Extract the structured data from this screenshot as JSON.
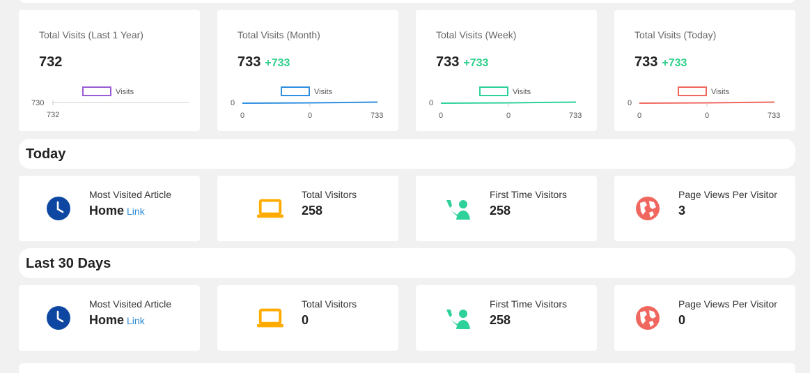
{
  "stats": [
    {
      "title": "Total Visits (Last 1 Year)",
      "value": "732",
      "delta": "",
      "legend": "Visits",
      "color": "#9a5dd6",
      "chart_data": {
        "type": "line",
        "series": [
          {
            "name": "Visits",
            "x": [
              "732"
            ],
            "y": [
              730
            ]
          }
        ],
        "ytick": "730",
        "xticks": [
          "732"
        ]
      }
    },
    {
      "title": "Total Visits (Month)",
      "value": "733",
      "delta": "+733",
      "legend": "Visits",
      "color": "#2f8fe0",
      "chart_data": {
        "type": "line",
        "series": [
          {
            "name": "Visits",
            "x": [
              "0",
              "0",
              "733"
            ],
            "y": [
              0,
              0,
              0
            ]
          }
        ],
        "ytick": "0",
        "xticks": [
          "0",
          "0",
          "733"
        ]
      }
    },
    {
      "title": "Total Visits (Week)",
      "value": "733",
      "delta": "+733",
      "legend": "Visits",
      "color": "#2ed19a",
      "chart_data": {
        "type": "line",
        "series": [
          {
            "name": "Visits",
            "x": [
              "0",
              "0",
              "733"
            ],
            "y": [
              0,
              0,
              0
            ]
          }
        ],
        "ytick": "0",
        "xticks": [
          "0",
          "0",
          "733"
        ]
      }
    },
    {
      "title": "Total Visits (Today)",
      "value": "733",
      "delta": "+733",
      "legend": "Visits",
      "color": "#f0675f",
      "chart_data": {
        "type": "line",
        "series": [
          {
            "name": "Visits",
            "x": [
              "0",
              "0",
              "733"
            ],
            "y": [
              0,
              0,
              0
            ]
          }
        ],
        "ytick": "0",
        "xticks": [
          "0",
          "0",
          "733"
        ]
      }
    }
  ],
  "today": {
    "title": "Today",
    "cards": [
      {
        "label": "Most Visited Article",
        "value": "Home",
        "link": "Link",
        "icon": "clock-icon",
        "color": "#0d47a1"
      },
      {
        "label": "Total Visitors",
        "value": "258",
        "icon": "laptop-icon",
        "color": "#ffab00"
      },
      {
        "label": "First Time Visitors",
        "value": "258",
        "icon": "person-phone-icon",
        "color": "#2ed19a"
      },
      {
        "label": "Page Views Per Visitor",
        "value": "3",
        "icon": "globe-icon",
        "color": "#f0675f"
      }
    ]
  },
  "last30": {
    "title": "Last 30 Days",
    "cards": [
      {
        "label": "Most Visited Article",
        "value": "Home",
        "link": "Link",
        "icon": "clock-icon",
        "color": "#0d47a1"
      },
      {
        "label": "Total Visitors",
        "value": "0",
        "icon": "laptop-icon",
        "color": "#ffab00"
      },
      {
        "label": "First Time Visitors",
        "value": "258",
        "icon": "person-phone-icon",
        "color": "#2ed19a"
      },
      {
        "label": "Page Views Per Visitor",
        "value": "0",
        "icon": "globe-icon",
        "color": "#f0675f"
      }
    ]
  }
}
